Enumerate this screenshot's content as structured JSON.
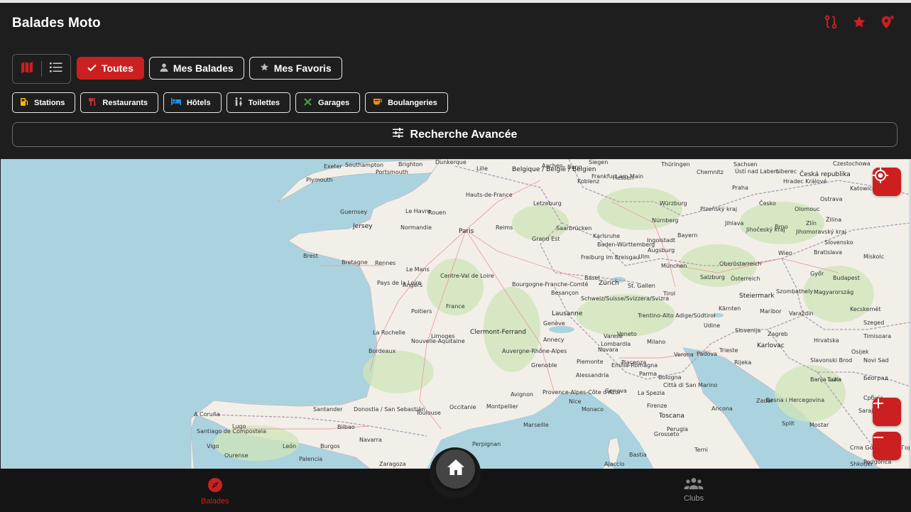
{
  "header": {
    "title": "Balades Moto",
    "icons": [
      "route-icon",
      "star-icon",
      "add-location-icon"
    ]
  },
  "view_toggle": {
    "map_icon": "map-icon",
    "list_icon": "list-icon"
  },
  "filters": [
    {
      "label": "Toutes",
      "icon": "check-icon",
      "active": true
    },
    {
      "label": "Mes Balades",
      "icon": "person-icon",
      "active": false
    },
    {
      "label": "Mes Favoris",
      "icon": "star-icon",
      "active": false
    }
  ],
  "poi": [
    {
      "label": "Stations",
      "icon": "fuel-icon",
      "color": "#f5b800"
    },
    {
      "label": "Restaurants",
      "icon": "restaurant-icon",
      "color": "#e53935"
    },
    {
      "label": "Hôtels",
      "icon": "hotel-icon",
      "color": "#2196f3"
    },
    {
      "label": "Toilettes",
      "icon": "wc-icon",
      "color": "#cccccc"
    },
    {
      "label": "Garages",
      "icon": "tools-icon",
      "color": "#43a047"
    },
    {
      "label": "Boulangeries",
      "icon": "bakery-icon",
      "color": "#fb8c00"
    }
  ],
  "advanced_search": {
    "label": "Recherche Avancée",
    "icon": "tune-icon"
  },
  "map": {
    "labels": [
      "Exeter",
      "Southampton",
      "Brighton",
      "Portsmouth",
      "Plymouth",
      "Dunkerque",
      "Lille",
      "Belgique / België / Belgien",
      "Aachen",
      "Bonn",
      "Koblenz",
      "Siegen",
      "Hessen",
      "Thüringen",
      "Chemnitz",
      "Sachsen",
      "Ústí nad Labem",
      "Liberec",
      "Česká republika",
      "Hradec Králové",
      "Czestochowa",
      "Katowice",
      "Guernsey",
      "Jersey",
      "Le Havre",
      "Rouen",
      "Hauts-de-France",
      "Letzeburg",
      "Frankfurt am Main",
      "Würzburg",
      "Praha",
      "Česko",
      "Olomouc",
      "Ostrava",
      "Normandie",
      "Paris",
      "Reims",
      "Saarbrücken",
      "Karlsruhe",
      "Nürnberg",
      "Plzeňský kraj",
      "Jihlava",
      "Brno",
      "Zlín",
      "Žilina",
      "Grand Est",
      "Ingolstadt",
      "Bayern",
      "Baden-Württemberg",
      "Jihočeský kraj",
      "Jihomoravský kraj",
      "Slovensko",
      "Brest",
      "Bretagne",
      "Rennes",
      "Le Mans",
      "Freiburg im Breisgau",
      "Ulm",
      "Augsburg",
      "München",
      "Wien",
      "Bratislava",
      "Miskolc",
      "Centre-Val de Loire",
      "Basel",
      "Zürich",
      "St. Gallen",
      "Salzburg",
      "Oberösterreich",
      "Österreich",
      "Győr",
      "Budapest",
      "Pays de la Loire",
      "Angers",
      "Bourgogne-Franche-Comté",
      "Besançon",
      "Schweiz/Suisse/Svizzera/Svizra",
      "Tirol",
      "Steiermark",
      "Szombathely",
      "Magyarország",
      "France",
      "Poitiers",
      "Lausanne",
      "Genève",
      "Trentino-Alto Adige/Südtirol",
      "Kärnten",
      "Maribor",
      "Varaždin",
      "Kecskemét",
      "La Rochelle",
      "Limoges",
      "Clermont-Ferrand",
      "Annecy",
      "Lombardia",
      "Veneto",
      "Udine",
      "Slovenija",
      "Zagreb",
      "Szeged",
      "Timisoara",
      "Auvergne-Rhône-Alpes",
      "Novara",
      "Varese",
      "Milano",
      "Verona",
      "Padova",
      "Trieste",
      "Karlovac",
      "Hrvatska",
      "Osijek",
      "Bordeaux",
      "Nouvelle-Aquitaine",
      "Grenoble",
      "Piemonte",
      "Piacenza",
      "Parma",
      "Bologna",
      "Rijeka",
      "Slavonski Brod",
      "Novi Sad",
      "Alessandria",
      "Emilia-Romagna",
      "Banja Luka",
      "Tuzla",
      "Београд",
      "Avignon",
      "Provence-Alpes-Côte d'Azur",
      "Genova",
      "La Spezia",
      "Città di San Marino",
      "Bosna i Hercegovina",
      "Србија",
      "Occitanie",
      "A Coruña",
      "Santander",
      "Donostia / San Sebastián",
      "Toulouse",
      "Montpellier",
      "Nice",
      "Monaco",
      "Firenze",
      "Ancona",
      "Zadar",
      "Sarajevo",
      "Lugo",
      "Bilbao",
      "Marseille",
      "Toscana",
      "Perugia",
      "Split",
      "Mostar",
      "Santiago de Compostela",
      "Vigo",
      "Ourense",
      "León",
      "Burgos",
      "Navarra",
      "Andorra",
      "Perpignan",
      "Grosseto",
      "Terni",
      "Crna Gora / Црна Гора",
      "Podgorica",
      "Palencia",
      "Zaragoza",
      "Ajaccio",
      "Bastia",
      "Shkodër"
    ]
  },
  "map_controls": [
    "locate-icon",
    "zoom-in-icon",
    "zoom-out-icon"
  ],
  "bottom_nav": {
    "left_label": "Balades",
    "right_label": "Clubs",
    "left_color": "#cc1f1f",
    "right_color": "#9a9a9a"
  },
  "colors": {
    "accent": "#cc1f1f",
    "header_bg": "#1e1e1e",
    "sea": "#aad3df",
    "land": "#f2efe9"
  }
}
